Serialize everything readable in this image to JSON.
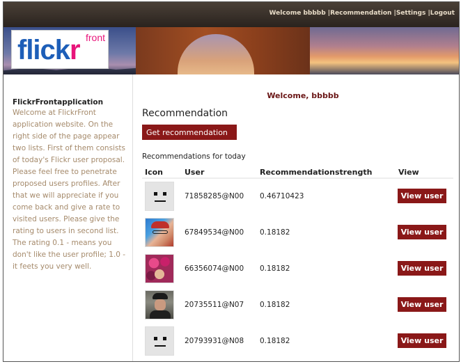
{
  "nav": {
    "welcome": "Welcome bbbbb",
    "sep": " |",
    "recommendation": "Recommendation",
    "settings": "Settings",
    "logout": "Logout"
  },
  "logo": {
    "flick": "flick",
    "r": "r",
    "front": "front"
  },
  "sidebar": {
    "title": "FlickrFrontapplication",
    "text": "Welcome at FlickrFront application website. On the right side of the page appear two lists. First of them consists of today's Flickr user proposal. Please feel free to penetrate proposed users profiles. After that we will appreciate if you come back and give a rate to visited users. Please give the rating to users in second list. The rating 0.1 - means you don't like the user profile; 1.0 - it feets you very well."
  },
  "main": {
    "welcome": "Welcome, bbbbb",
    "title": "Recommendation",
    "get_button": "Get recommendation",
    "today": "Recommendations for today"
  },
  "table": {
    "headers": [
      "Icon",
      "User",
      "Recommendationstrength",
      "View"
    ],
    "rows": [
      {
        "icon": "default-avatar",
        "user": "71858285@N00",
        "strength": "0.46710423",
        "view": "View user"
      },
      {
        "icon": "photo-avatar-person-glasses",
        "user": "67849534@N00",
        "strength": "0.18182",
        "view": "View user"
      },
      {
        "icon": "photo-avatar-flowers",
        "user": "66356074@N00",
        "strength": "0.18182",
        "view": "View user"
      },
      {
        "icon": "photo-avatar-man-hat",
        "user": "20735511@N07",
        "strength": "0.18182",
        "view": "View user"
      },
      {
        "icon": "default-avatar",
        "user": "20793931@N08",
        "strength": "0.18182",
        "view": "View user"
      }
    ]
  },
  "colors": {
    "accent": "#8a1818",
    "sidebar_text": "#a58a6b",
    "welcome": "#6a1616"
  }
}
